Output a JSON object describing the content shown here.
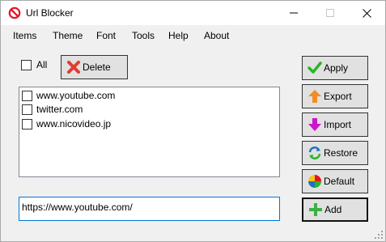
{
  "window": {
    "title": "Url Blocker",
    "app_icon": "prohibited-icon",
    "controls": [
      "minimize-icon",
      "maximize-icon",
      "close-icon"
    ]
  },
  "menu": {
    "items": [
      "Items",
      "Theme",
      "Font",
      "Tools",
      "Help",
      "About"
    ]
  },
  "toolbar": {
    "all_label": "All",
    "all_checked": false,
    "delete_label": "Delete"
  },
  "list": {
    "items": [
      {
        "url": "www.youtube.com",
        "checked": false
      },
      {
        "url": "twitter.com",
        "checked": false
      },
      {
        "url": "www.nicovideo.jp",
        "checked": false
      }
    ]
  },
  "input": {
    "value": "https://www.youtube.com/"
  },
  "side_buttons": {
    "apply": "Apply",
    "export": "Export",
    "import": "Import",
    "restore": "Restore",
    "default": "Default",
    "add": "Add"
  },
  "colors": {
    "prohibited_red": "#e81123",
    "apply_green": "#2ab52a",
    "export_orange": "#f28c28",
    "import_magenta": "#cc16cc",
    "restore_blue": "#1e73be",
    "add_green": "#3cb043",
    "delete_red": "#e03c31",
    "focus_blue": "#0078d7"
  }
}
